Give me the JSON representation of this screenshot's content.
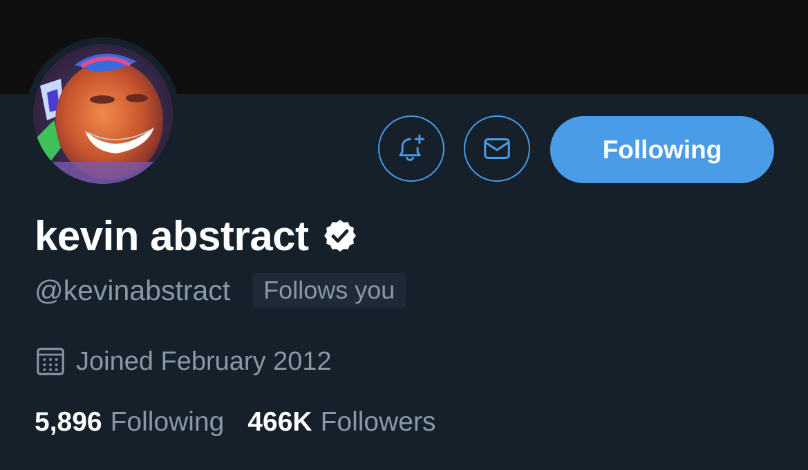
{
  "colors": {
    "background": "#15202b",
    "banner": "#0f0f0f",
    "accent": "#4a9be8",
    "primary_text": "#ffffff",
    "secondary_text": "#8899a6"
  },
  "profile": {
    "display_name": "kevin abstract",
    "verified": true,
    "handle": "@kevinabstract",
    "follows_you_label": "Follows you",
    "joined": "Joined February 2012"
  },
  "actions": {
    "notify_icon": "bell-plus-icon",
    "message_icon": "envelope-icon",
    "follow_label": "Following"
  },
  "stats": {
    "following_count": "5,896",
    "following_label": "Following",
    "followers_count": "466K",
    "followers_label": "Followers"
  }
}
